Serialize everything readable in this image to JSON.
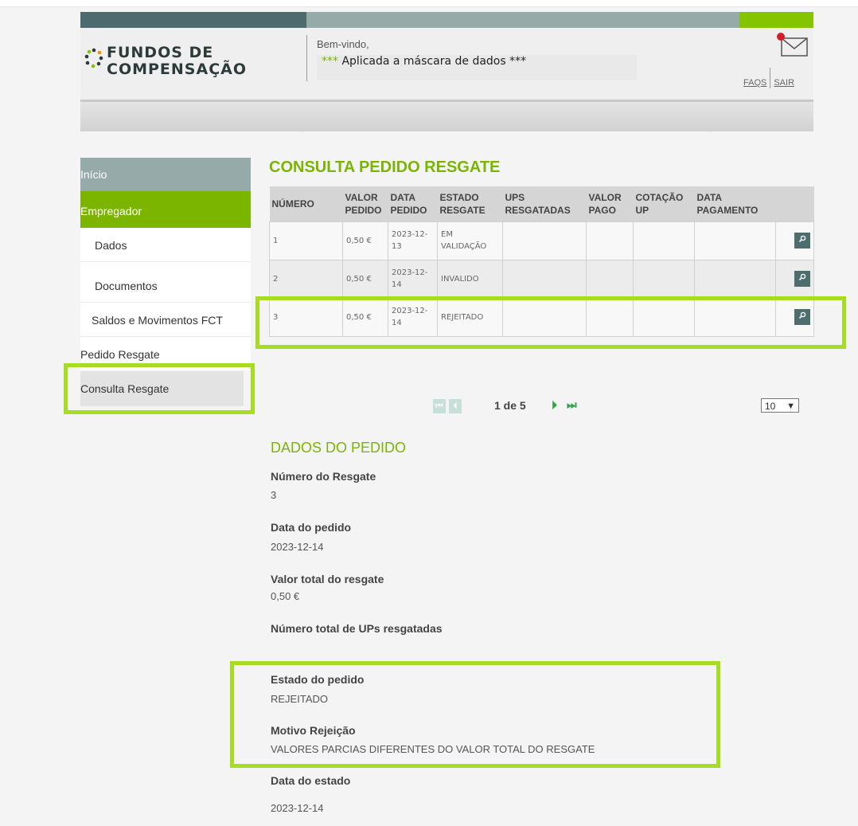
{
  "brand": {
    "line1": "FUNDOS DE",
    "line2": "COMPENSAÇÃO"
  },
  "header": {
    "welcome_label": "Bem-vindo,",
    "welcome_stars": "***",
    "welcome_message": "Aplicada a máscara de dados ***",
    "faqs": "FAQS",
    "logout": "SAIR"
  },
  "sidebar": {
    "items": [
      {
        "label": "Início"
      },
      {
        "label": "Empregador"
      },
      {
        "label": "Dados"
      },
      {
        "label": "Documentos"
      },
      {
        "label": "Saldos e Movimentos FCT"
      },
      {
        "label": "Pedido Resgate"
      },
      {
        "label": "Consulta Resgate"
      }
    ]
  },
  "main": {
    "title": "CONSULTA PEDIDO RESGATE",
    "columns": [
      "NÚMERO",
      "VALOR PEDIDO",
      "DATA PEDIDO",
      "ESTADO RESGATE",
      "UPS RESGATADAS",
      "VALOR PAGO",
      "COTAÇÃO UP",
      "DATA PAGAMENTO"
    ],
    "rows": [
      {
        "numero": "1",
        "valor": "0,50 €",
        "data": "2023-12-13",
        "estado": "EM VALIDAÇÃO",
        "ups": "",
        "pago": "",
        "cotacao": "",
        "data_pag": ""
      },
      {
        "numero": "2",
        "valor": "0,50 €",
        "data": "2023-12-14",
        "estado": "INVALIDO",
        "ups": "",
        "pago": "",
        "cotacao": "",
        "data_pag": ""
      },
      {
        "numero": "3",
        "valor": "0,50 €",
        "data": "2023-12-14",
        "estado": "REJEITADO",
        "ups": "",
        "pago": "",
        "cotacao": "",
        "data_pag": ""
      }
    ],
    "pagination": {
      "text": "1 de 5",
      "page_size": "10"
    }
  },
  "details": {
    "title": "DADOS DO PEDIDO",
    "fields": [
      {
        "label": "Número do Resgate",
        "value": "3"
      },
      {
        "label": "Data do pedido",
        "value": "2023-12-14"
      },
      {
        "label": "Valor total do resgate",
        "value": "0,50 €"
      },
      {
        "label": "Número total de UPs resgatadas",
        "value": ""
      },
      {
        "label": "Estado do pedido",
        "value": "REJEITADO"
      },
      {
        "label": "Motivo Rejeição",
        "value": "VALORES PARCIAS DIFERENTES DO VALOR TOTAL DO RESGATE"
      },
      {
        "label": "Data do estado",
        "value": "2023-12-14"
      }
    ]
  },
  "colors": {
    "accent": "#7cb500",
    "highlight": "#a6dc21",
    "nav_grey": "#95aaa9",
    "dark_teal": "#4d6b6e"
  },
  "icons": [
    "logo-icon",
    "mail-icon",
    "notification-dot-icon",
    "magnifier-icon",
    "first-page-icon",
    "prev-page-icon",
    "next-page-icon",
    "last-page-icon",
    "chevron-down-icon"
  ]
}
